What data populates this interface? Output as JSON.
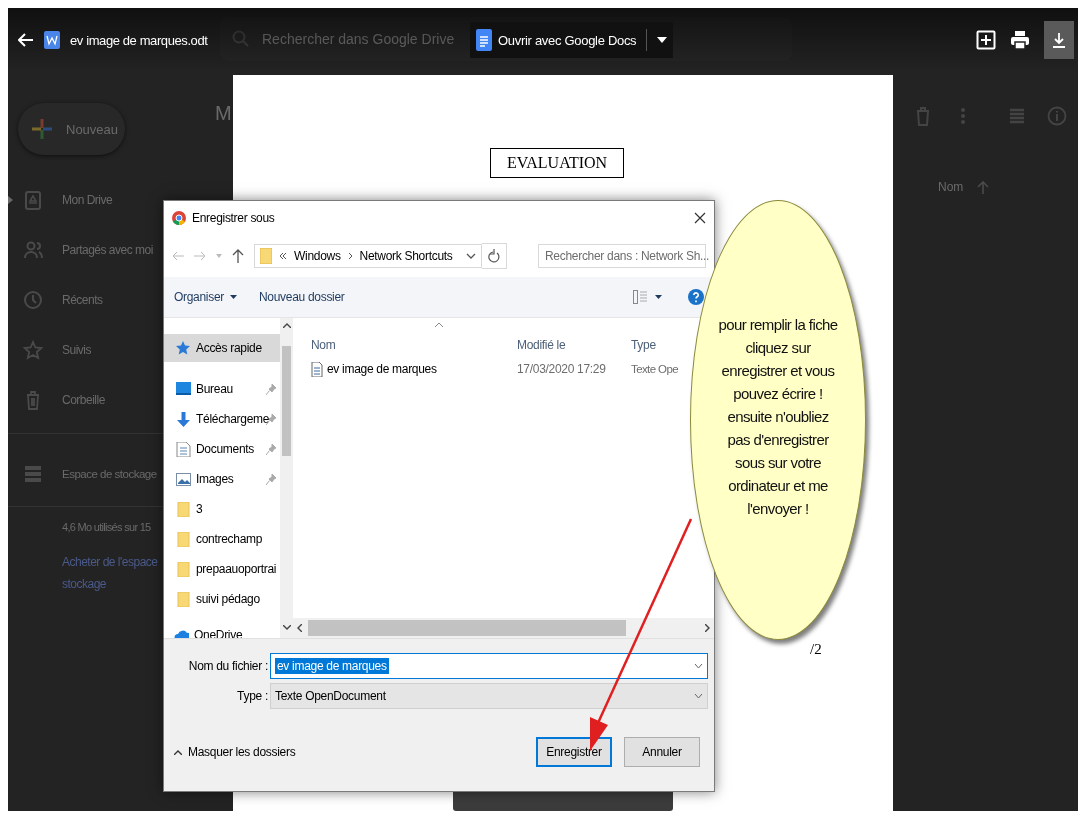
{
  "drive": {
    "search_placeholder": "Rechercher dans Google Drive",
    "new_button": "Nouveau",
    "heading": "M",
    "nav": [
      {
        "label": "Mon Drive",
        "expandable": true
      },
      {
        "label": "Partagés avec moi",
        "expandable": false
      },
      {
        "label": "Récents",
        "expandable": false
      },
      {
        "label": "Suivis",
        "expandable": false
      },
      {
        "label": "Corbeille",
        "expandable": false
      }
    ],
    "storage": {
      "label": "Espace de stockage",
      "usage": "4,6 Mo utilisés sur 15",
      "buy_link": [
        "Acheter de l'espace",
        "stockage"
      ]
    },
    "list_header": "Nom"
  },
  "viewer": {
    "file_name": "ev image de marques.odt",
    "open_with": "Ouvrir avec Google Docs"
  },
  "document": {
    "heading": "EVALUATION",
    "page_mark": "/2"
  },
  "dialog": {
    "title": "Enregistrer sous",
    "path": [
      "Windows",
      "Network Shortcuts"
    ],
    "search_placeholder": "Rechercher dans : Network Sh...",
    "toolbar": [
      "Organiser",
      "Nouveau dossier"
    ],
    "nav": [
      {
        "label": "Accès rapide",
        "kind": "quick",
        "selected": true,
        "pinned": false
      },
      {
        "label": "Bureau",
        "kind": "desktop",
        "selected": false,
        "pinned": true
      },
      {
        "label": "Téléchargeme",
        "kind": "download",
        "selected": false,
        "pinned": true
      },
      {
        "label": "Documents",
        "kind": "documents",
        "selected": false,
        "pinned": true
      },
      {
        "label": "Images",
        "kind": "pictures",
        "selected": false,
        "pinned": true
      },
      {
        "label": "3",
        "kind": "folder",
        "selected": false,
        "pinned": false
      },
      {
        "label": "contrechamp",
        "kind": "folder",
        "selected": false,
        "pinned": false
      },
      {
        "label": "prepaauoportrai",
        "kind": "folder",
        "selected": false,
        "pinned": false
      },
      {
        "label": "suivi pédago",
        "kind": "folder",
        "selected": false,
        "pinned": false
      },
      {
        "label": "OneDrive",
        "kind": "cloud",
        "selected": false,
        "pinned": false
      }
    ],
    "columns": [
      "Nom",
      "Modifié le",
      "Type"
    ],
    "files": [
      {
        "name": "ev  image de marques",
        "modified": "17/03/2020 17:29",
        "type": "Texte Ope"
      }
    ],
    "filename_label": "Nom du fichier :",
    "filename_value": "ev  image de marques",
    "type_label": "Type :",
    "type_value": "Texte OpenDocument",
    "hide_folders": "Masquer les dossiers",
    "buttons": [
      "Enregistrer",
      "Annuler"
    ]
  },
  "callout": {
    "text": "pour remplir la fiche cliquez sur enregistrer et vous pouvez écrire ! ensuite n'oubliez pas d'enregistrer sous sur votre ordinateur et me l'envoyer !"
  }
}
